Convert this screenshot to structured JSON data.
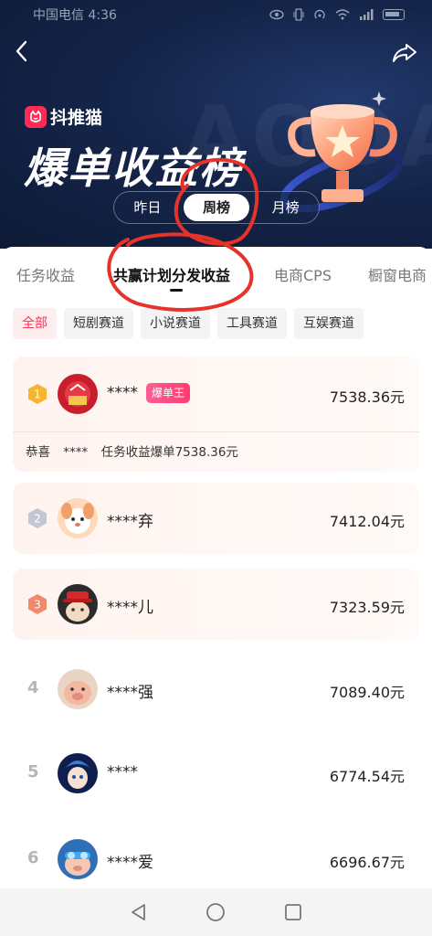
{
  "status_bar": {
    "carrier_time": "中国电信 4:36",
    "icons": [
      "eye-icon",
      "vibrate-icon",
      "hotspot-icon",
      "wifi-icon",
      "signal-icon",
      "battery-icon"
    ]
  },
  "header": {
    "brand_name": "抖推猫",
    "title": "爆单收益榜",
    "watermark": "AODA",
    "period_tabs": [
      {
        "label": "昨日",
        "active": false
      },
      {
        "label": "周榜",
        "active": true
      },
      {
        "label": "月榜",
        "active": false
      }
    ]
  },
  "category_tabs": [
    {
      "label": "任务收益",
      "active": false
    },
    {
      "label": "共赢计划分发收益",
      "active": true
    },
    {
      "label": "电商CPS",
      "active": false
    },
    {
      "label": "橱窗电商",
      "active": false
    }
  ],
  "filter_chips": [
    {
      "label": "全部",
      "active": true
    },
    {
      "label": "短剧赛道",
      "active": false
    },
    {
      "label": "小说赛道",
      "active": false
    },
    {
      "label": "工具赛道",
      "active": false
    },
    {
      "label": "互娱赛道",
      "active": false
    }
  ],
  "ranking": [
    {
      "rank": "1",
      "name": "****",
      "amount": "7538.36元",
      "badge": "爆单王",
      "note_prefix": "恭喜",
      "note_name": "****",
      "note_text": "任务收益爆单7538.36元",
      "avatar": "gift-box-avatar"
    },
    {
      "rank": "2",
      "name": "****弃",
      "amount": "7412.04元",
      "avatar": "cartoon-dog-avatar"
    },
    {
      "rank": "3",
      "name": "****儿",
      "amount": "7323.59元",
      "avatar": "cat-in-hat-avatar"
    },
    {
      "rank": "4",
      "name": "****强",
      "amount": "7089.40元",
      "avatar": "pig-avatar"
    },
    {
      "rank": "5",
      "name": "****",
      "amount": "6774.54元",
      "avatar": "anime-boy-avatar"
    },
    {
      "rank": "6",
      "name": "****爱",
      "amount": "6696.67元",
      "avatar": "pig-goggles-avatar"
    }
  ],
  "colors": {
    "header_bg": "#0d1a37",
    "accent": "#ff2d4f",
    "gold": "#f5b52e",
    "silver": "#c2c7d3",
    "bronze": "#f08a6a"
  }
}
